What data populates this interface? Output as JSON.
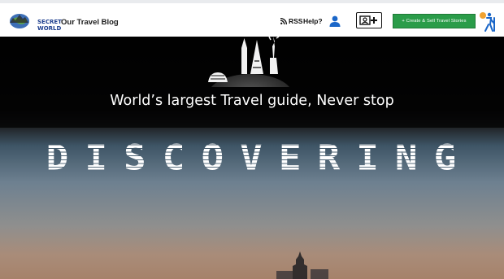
{
  "header": {
    "logo_line1": "SECRET",
    "logo_line2": "WORLD",
    "blog_link": "Our Travel Blog",
    "rss_label": "RSS",
    "help_label": "Help?",
    "create_button": "+ Create & Sell Travel Stories",
    "icons": [
      "rss-icon",
      "user-icon",
      "add-video-icon",
      "hiker-icon"
    ]
  },
  "hero": {
    "tagline": "World’s largest Travel guide, Never stop",
    "headline": "DISCOVERING"
  },
  "colors": {
    "accent_green": "#2a9c49",
    "logo_blue": "#1e3f8f",
    "user_blue": "#1a66c8"
  }
}
